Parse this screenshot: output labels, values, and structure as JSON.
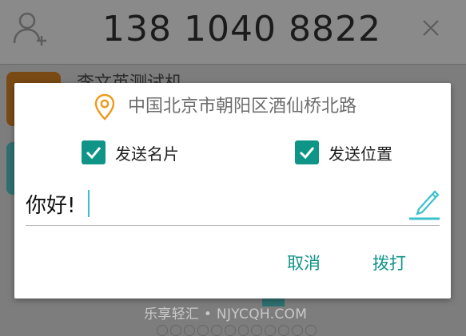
{
  "background_app": {
    "phone_number": "138 1040 8822",
    "first_contact_partial": "李文英测试机"
  },
  "dialog": {
    "location": "中国北京市朝阳区酒仙桥北路",
    "options": [
      {
        "label": "发送名片",
        "checked": true
      },
      {
        "label": "发送位置",
        "checked": true
      }
    ],
    "message": "你好!",
    "buttons": {
      "cancel": "取消",
      "dial": "拨打"
    }
  },
  "watermark": "乐享轻汇 • NJYCQH.COM",
  "colors": {
    "accent": "#0f9488",
    "location_icon": "#f09a1a",
    "caret": "#3cc0cc",
    "pencil": "#3cc0cc"
  }
}
